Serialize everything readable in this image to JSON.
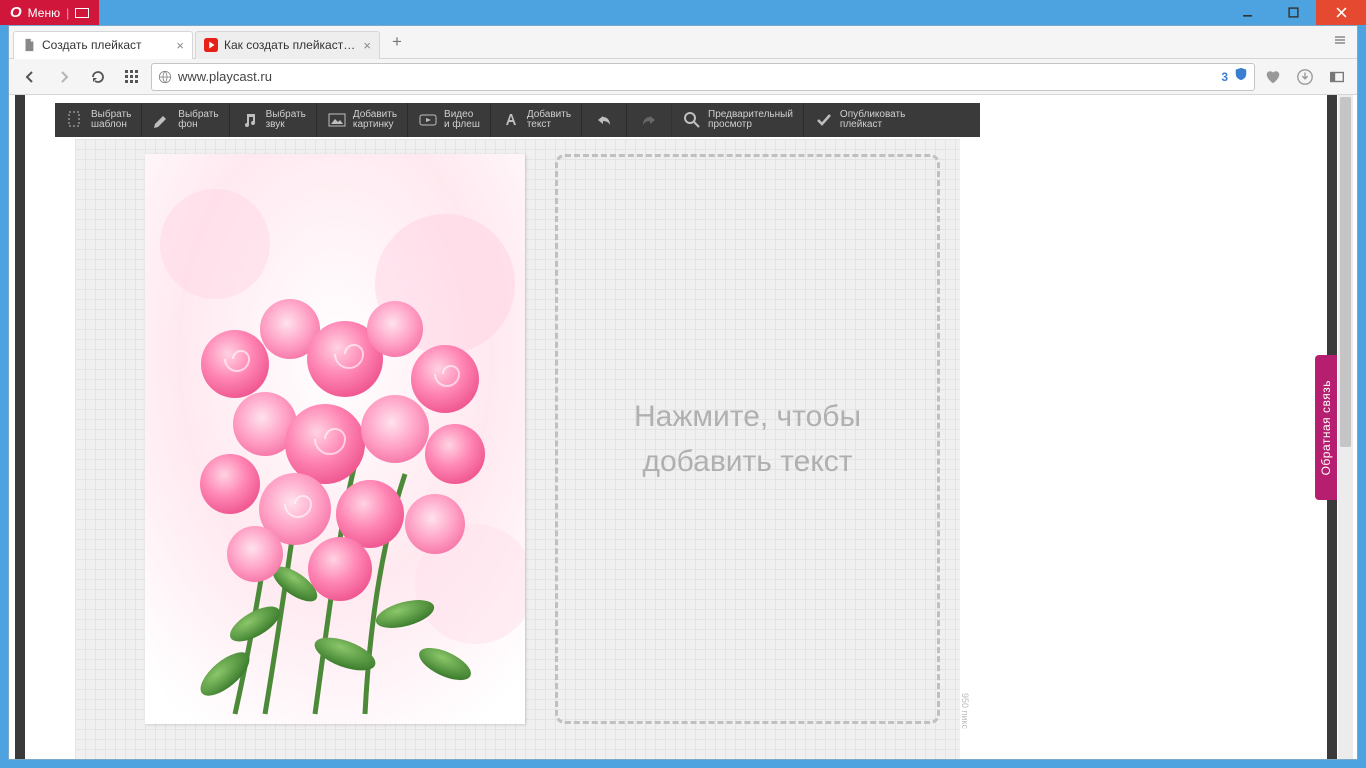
{
  "window": {
    "menu_label": "Меню"
  },
  "tabs": [
    {
      "title": "Создать плейкаст"
    },
    {
      "title": "Как создать плейкаст - Yo"
    }
  ],
  "url": "www.playcast.ru",
  "url_badge": "3",
  "toolbar": [
    {
      "l1": "Выбрать",
      "l2": "шаблон"
    },
    {
      "l1": "Выбрать",
      "l2": "фон"
    },
    {
      "l1": "Выбрать",
      "l2": "звук"
    },
    {
      "l1": "Добавить",
      "l2": "картинку"
    },
    {
      "l1": "Видео",
      "l2": "и флеш"
    },
    {
      "l1": "Добавить",
      "l2": "текст"
    },
    {
      "l1": "Предварительный",
      "l2": "просмотр"
    },
    {
      "l1": "Опубликовать",
      "l2": "плейкаст"
    }
  ],
  "text_placeholder_l1": "Нажмите, чтобы",
  "text_placeholder_l2": "добавить текст",
  "ruler": "950 пикс",
  "feedback": "Обратная связь"
}
